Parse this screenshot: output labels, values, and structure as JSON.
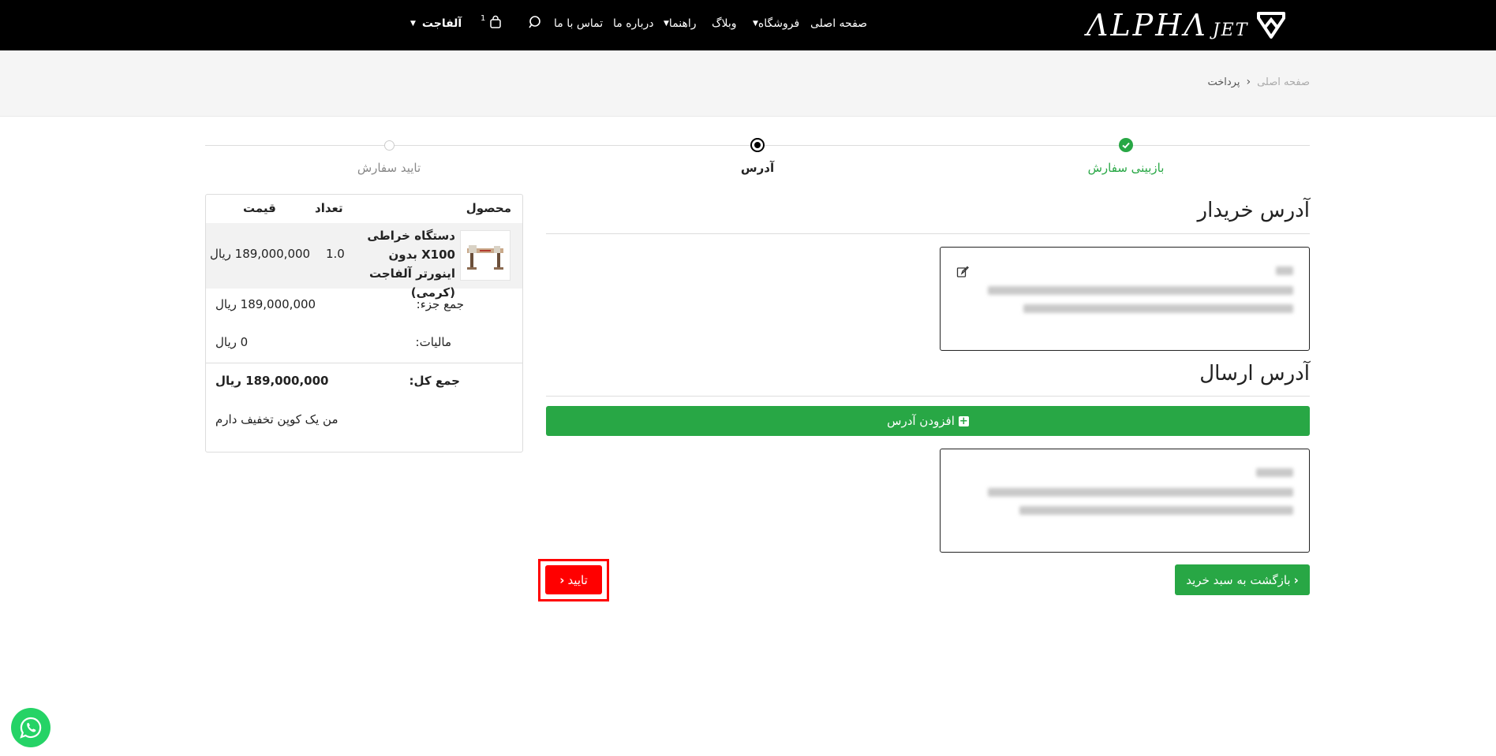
{
  "header": {
    "logo_text": "ΛLPHΛ",
    "logo_sub": "JET",
    "nav": {
      "home": "صفحه اصلی",
      "shop": "فروشگاه",
      "blog": "وبلاگ",
      "guide": "راهنما",
      "about": "درباره ما",
      "contact": "تماس با ما",
      "account": "آلفاجت"
    },
    "cart_count": "1",
    "colors": {
      "bar": "#000000",
      "text": "#ffffff"
    },
    "icons": [
      "logo-mark-icon",
      "search-icon",
      "shopping-bag-icon",
      "caret-down-icon"
    ]
  },
  "breadcrumb": {
    "home": "صفحه اصلی",
    "current": "پرداخت"
  },
  "steps": [
    {
      "label": "بازبینی سفارش",
      "state": "done"
    },
    {
      "label": "آدرس",
      "state": "active"
    },
    {
      "label": "تایید سفارش",
      "state": "pending"
    }
  ],
  "buyer_address": {
    "title": "آدرس خریدار"
  },
  "shipping_address": {
    "title": "آدرس ارسال",
    "add_button": "افزودن آدرس"
  },
  "summary": {
    "headers": {
      "product": "محصول",
      "qty": "تعداد",
      "price": "قیمت"
    },
    "item": {
      "name": "دستگاه خراطی X100 بدون اینورتر آلفاجت (کرمی)",
      "qty": "1.0",
      "price": "189,000,000 ریال"
    },
    "subtotal_label": "جمع جزء:",
    "subtotal_value": "189,000,000 ریال",
    "tax_label": "مالیات:",
    "tax_value": "0 ریال",
    "total_label": "جمع کل:",
    "total_value": "189,000,000 ریال",
    "coupon_text": "من یک کوپن تخفیف دارم"
  },
  "buttons": {
    "back": "بازگشت به سبد خرید",
    "confirm": "تایید"
  },
  "colors": {
    "green": "#28a745",
    "red": "#ff0000",
    "whatsapp": "#25d366"
  }
}
